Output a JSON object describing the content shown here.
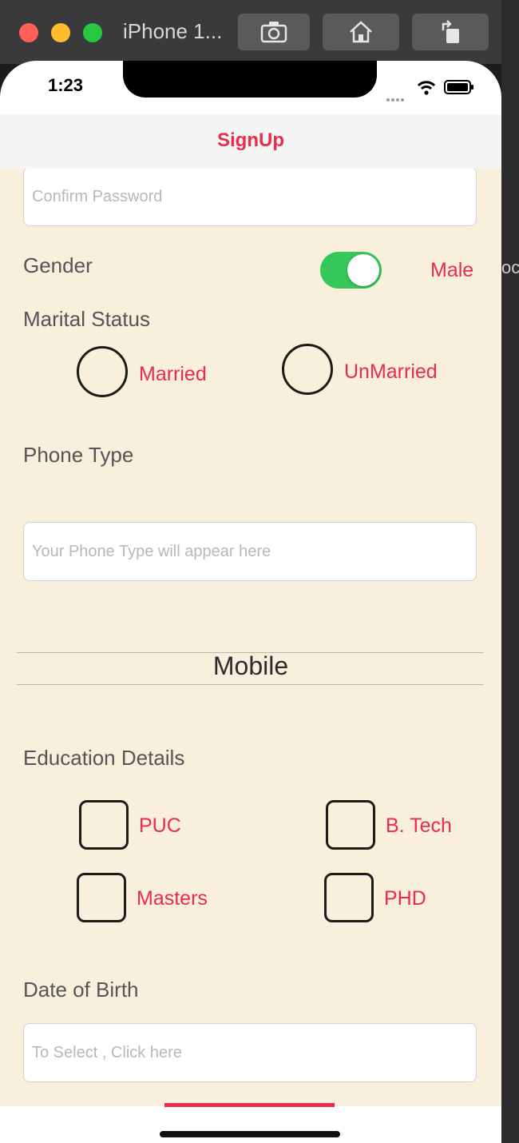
{
  "simulator": {
    "title": "iPhone 1...",
    "buttons": [
      "camera-icon",
      "home-icon",
      "rotate-icon"
    ],
    "side_text": "oc"
  },
  "status_bar": {
    "time": "1:23"
  },
  "nav": {
    "title": "SignUp"
  },
  "form": {
    "confirm_password": {
      "placeholder": "Confirm Password",
      "value": ""
    },
    "gender": {
      "label": "Gender",
      "toggle_on": true,
      "value_text": "Male"
    },
    "marital_status": {
      "label": "Marital Status",
      "options": [
        "Married",
        "UnMarried"
      ]
    },
    "phone_type": {
      "label": "Phone Type",
      "placeholder": "Your Phone Type will appear here",
      "picker_selected": "Mobile"
    },
    "education": {
      "label": "Education Details",
      "options": [
        "PUC",
        "B. Tech",
        "Masters",
        "PHD"
      ]
    },
    "dob": {
      "label": "Date of Birth",
      "placeholder": "To Select , Click here"
    }
  },
  "colors": {
    "accent": "#ea2c4b",
    "toggle_on": "#35c759",
    "background": "#f8efdc"
  }
}
